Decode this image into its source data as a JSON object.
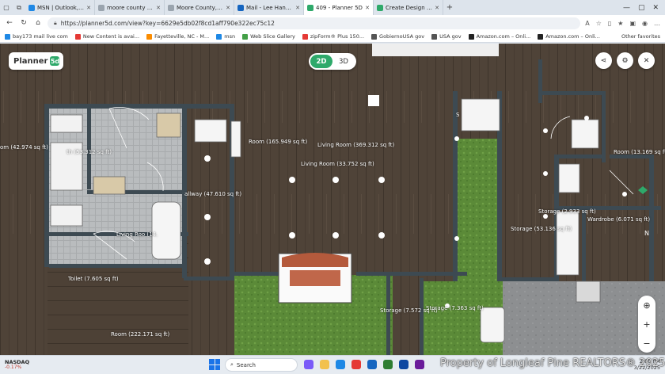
{
  "browser": {
    "tabs": [
      {
        "title": "MSN | Outlook, Office, Skyp",
        "favicon_color": "#1e88e5",
        "active": false
      },
      {
        "title": "moore county register of de",
        "favicon_color": "#9aa4ae",
        "active": false
      },
      {
        "title": "Moore County, NC",
        "favicon_color": "#9aa4ae",
        "active": false
      },
      {
        "title": "Mail - Lee Handsel - Outloo",
        "favicon_color": "#1565c0",
        "active": false
      },
      {
        "title": "409 - Planner 5D",
        "favicon_color": "#2ea96a",
        "active": true
      },
      {
        "title": "Create Design in a Room Pl",
        "favicon_color": "#2ea96a",
        "active": false
      }
    ],
    "new_tab_glyph": "+",
    "url": "https://planner5d.com/view?key=6629e5db02f8cd1aff790e322ec75c12",
    "bookmarks": [
      {
        "label": "bay173 mail live com",
        "color": "#1e88e5"
      },
      {
        "label": "New Content is avai...",
        "color": "#e53935"
      },
      {
        "label": "Fayetteville, NC - M...",
        "color": "#fb8c00"
      },
      {
        "label": "msn",
        "color": "#1e88e5"
      },
      {
        "label": "Web Slice Gallery",
        "color": "#43a047"
      },
      {
        "label": "zipForm® Plus 150...",
        "color": "#e53935"
      },
      {
        "label": "GobiernoUSA gov",
        "color": "#555555"
      },
      {
        "label": "USA gov",
        "color": "#555555"
      },
      {
        "label": "Amazon.com – Onli...",
        "color": "#222222"
      },
      {
        "label": "Amazon.com – Onli...",
        "color": "#222222"
      }
    ],
    "other_favorites": "Other favorites"
  },
  "planner": {
    "logo_text": "Planner",
    "logo_mark": "5d",
    "mode_2d": "2D",
    "mode_3d": "3D",
    "active_mode": "2D",
    "zoom_in": "+",
    "zoom_out": "−",
    "recenter": "⊕",
    "compass": "N",
    "room_labels": [
      {
        "id": "room-left-edge",
        "text": "om (42.974 sq ft)"
      },
      {
        "id": "bath-upper",
        "text": "th (53.312 sq ft)"
      },
      {
        "id": "room-165",
        "text": "Room (165.949 sq ft)"
      },
      {
        "id": "living-369",
        "text": "Living Room (369.312 sq ft)"
      },
      {
        "id": "living-33",
        "text": "Living Room (33.752 sq ft)"
      },
      {
        "id": "hallway",
        "text": "allway (47.610 sq ft)"
      },
      {
        "id": "living-small",
        "text": "Living Roo   (14."
      },
      {
        "id": "toilet",
        "text": "Toilet (7.605 sq ft)"
      },
      {
        "id": "room-222",
        "text": "Room (222.171 sq ft)"
      },
      {
        "id": "storage-757",
        "text": "Storage (7.572 sq ft)"
      },
      {
        "id": "storage-736",
        "text": "Storage (7.363 sq ft)"
      },
      {
        "id": "storage-53",
        "text": "Storage (53.136 sq ft)"
      },
      {
        "id": "storage-2933",
        "text": "Storage (2.933 sq ft)"
      },
      {
        "id": "wardrobe",
        "text": "Wardrobe (6.071 sq ft)"
      },
      {
        "id": "room-13",
        "text": "Room (13.169 sq ft)"
      },
      {
        "id": "shower-s",
        "text": "S"
      }
    ]
  },
  "taskbar": {
    "ticker_name": "NASDAQ",
    "ticker_value": "-0.17%",
    "search_placeholder": "Search",
    "time": "2:00 PM",
    "date": "3/22/2025"
  },
  "watermark": "Property of Longleaf Pine REALTORS® 2025",
  "colors": {
    "accent": "#2ea96a",
    "floor_wood": "#4f4338",
    "wall": "#3d4a52",
    "tile": "#b5b8ba",
    "grass": "#5c8c3a"
  }
}
